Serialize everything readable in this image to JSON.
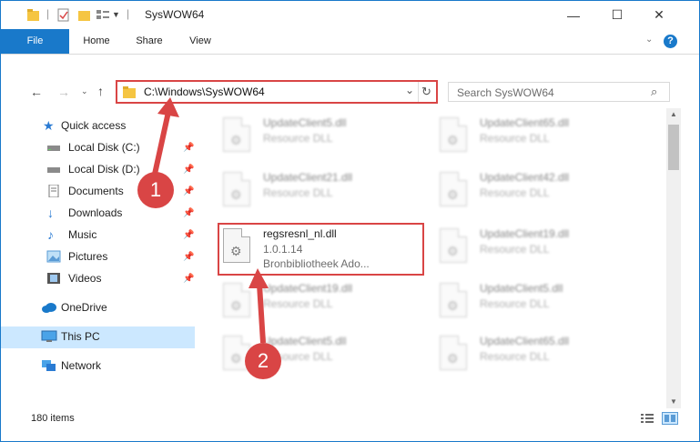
{
  "window": {
    "title": "SysWOW64",
    "minimize_glyph": "—",
    "maximize_glyph": "☐",
    "close_glyph": "✕"
  },
  "ribbon": {
    "tabs": [
      "File",
      "Home",
      "Share",
      "View"
    ],
    "accent": "#1979ca"
  },
  "address": {
    "path": "C:\\Windows\\SysWOW64",
    "search_placeholder": "Search SysWOW64"
  },
  "nav": {
    "items": [
      {
        "label": "Quick access",
        "icon": "star-icon"
      },
      {
        "label": "Local Disk (C:)",
        "icon": "drive-icon",
        "pinned": true
      },
      {
        "label": "Local Disk (D:)",
        "icon": "drive-icon",
        "pinned": true
      },
      {
        "label": "Documents",
        "icon": "documents-icon",
        "pinned": true
      },
      {
        "label": "Downloads",
        "icon": "download-icon",
        "pinned": true
      },
      {
        "label": "Music",
        "icon": "music-icon",
        "pinned": true
      },
      {
        "label": "Pictures",
        "icon": "pictures-icon",
        "pinned": true
      },
      {
        "label": "Videos",
        "icon": "videos-icon",
        "pinned": true
      },
      {
        "label": "OneDrive",
        "icon": "cloud-icon"
      },
      {
        "label": "This PC",
        "icon": "computer-icon",
        "selected": true
      },
      {
        "label": "Network",
        "icon": "network-icon"
      }
    ]
  },
  "files": {
    "left": [
      {
        "name": "UpdateClient5.dll",
        "desc": "Resource DLL"
      },
      {
        "name": "UpdateClient21.dll",
        "desc": "Resource DLL"
      },
      {
        "name": "regsresnl_nl.dll",
        "version": "1.0.1.14",
        "desc": "Bronbibliotheek Ado...",
        "highlighted": true
      },
      {
        "name": "UpdateClient19.dll",
        "desc": "Resource DLL"
      },
      {
        "name": "UpdateClient5.dll",
        "desc": "Resource DLL"
      }
    ],
    "right": [
      {
        "name": "UpdateClient65.dll",
        "desc": "Resource DLL"
      },
      {
        "name": "UpdateClient42.dll",
        "desc": "Resource DLL"
      },
      {
        "name": "UpdateClient19.dll",
        "desc": "Resource DLL"
      },
      {
        "name": "UpdateClient5.dll",
        "desc": "Resource DLL"
      },
      {
        "name": "UpdateClient65.dll",
        "desc": "Resource DLL"
      }
    ]
  },
  "status": {
    "item_count": "180 items"
  },
  "callouts": [
    "1",
    "2"
  ],
  "colors": {
    "highlight_red": "#d94545",
    "selection": "#cce8ff"
  }
}
